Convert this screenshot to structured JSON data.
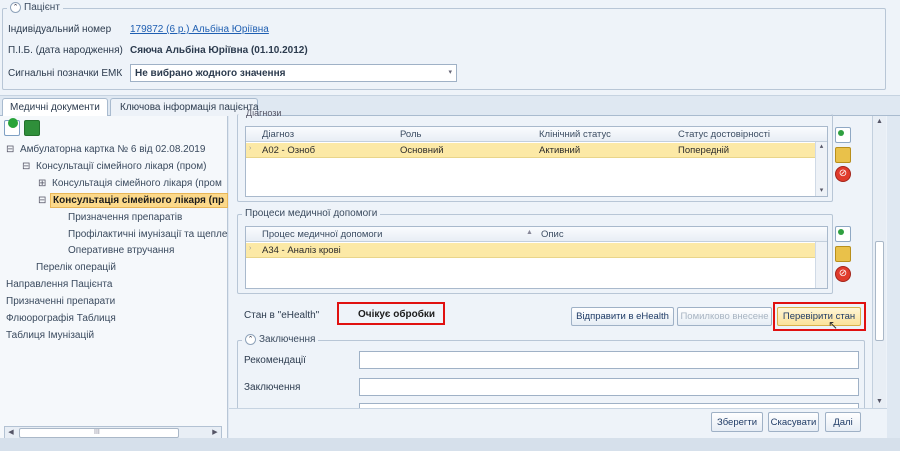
{
  "patient": {
    "section_title": "Пацієнт",
    "id_label": "Індивідуальний номер",
    "id_value": "179872 (6 р.) Альбіна Юріївна",
    "name_label": "П.І.Б. (дата народження)",
    "name_value": "Сяюча Альбіна Юріївна (01.10.2012)",
    "signal_label": "Сигнальні позначки ЕМК",
    "signal_value": "Не вибрано жодного значення"
  },
  "tabs": [
    {
      "label": "Медичні документи"
    },
    {
      "label": "Ключова інформація пацієнта"
    }
  ],
  "tree": {
    "items": [
      {
        "label": "Амбулаторна картка № 6 від 02.08.2019",
        "expander": "⊟"
      },
      {
        "label": "Консультації сімейного лікаря (пром)",
        "expander": "⊟"
      },
      {
        "label": "Консультація сімейного лікаря (пром",
        "expander": "⊞"
      },
      {
        "label": "Консультація сімейного лікаря (пр",
        "expander": "⊟"
      },
      {
        "label": "Призначення препаратів"
      },
      {
        "label": "Профілактичні імунізації та щепле"
      },
      {
        "label": "Оперативне втручання"
      },
      {
        "label": "Перелік операцій"
      },
      {
        "label": "Направлення Пацієнта"
      },
      {
        "label": "Призначенні препарати"
      },
      {
        "label": "Флюорографія Таблиця"
      },
      {
        "label": "Таблиця Імунізацій"
      }
    ],
    "scroll_glyph": "III"
  },
  "diagnoses": {
    "title": "Діагнози",
    "columns": [
      "Діагноз",
      "Роль",
      "Клінічний статус",
      "Статус достовірності"
    ],
    "rows": [
      [
        "А02 - Озноб",
        "Основний",
        "Активний",
        "Попередній"
      ]
    ]
  },
  "processes": {
    "title": "Процеси медичної допомоги",
    "columns": [
      "Процес медичної допомоги",
      "Опис"
    ],
    "rows": [
      [
        "А34 - Аналіз крові",
        ""
      ]
    ]
  },
  "ehealth": {
    "status_label": "Стан в \"eHealth\"",
    "status_value": "Очікує обробки",
    "send_button": "Відправити в eHealth",
    "error_button": "Помилково внесене",
    "check_button": "Перевірити стан"
  },
  "conclusion": {
    "title": "Заключення",
    "recommendations_label": "Рекомендації",
    "conclusion_label": "Заключення"
  },
  "footer": {
    "save": "Зберегти",
    "cancel": "Скасувати",
    "next": "Далі"
  },
  "colors": {
    "highlight_row": "#fce9a6",
    "callout_red": "#e01010",
    "link_blue": "#1f5fb2"
  }
}
